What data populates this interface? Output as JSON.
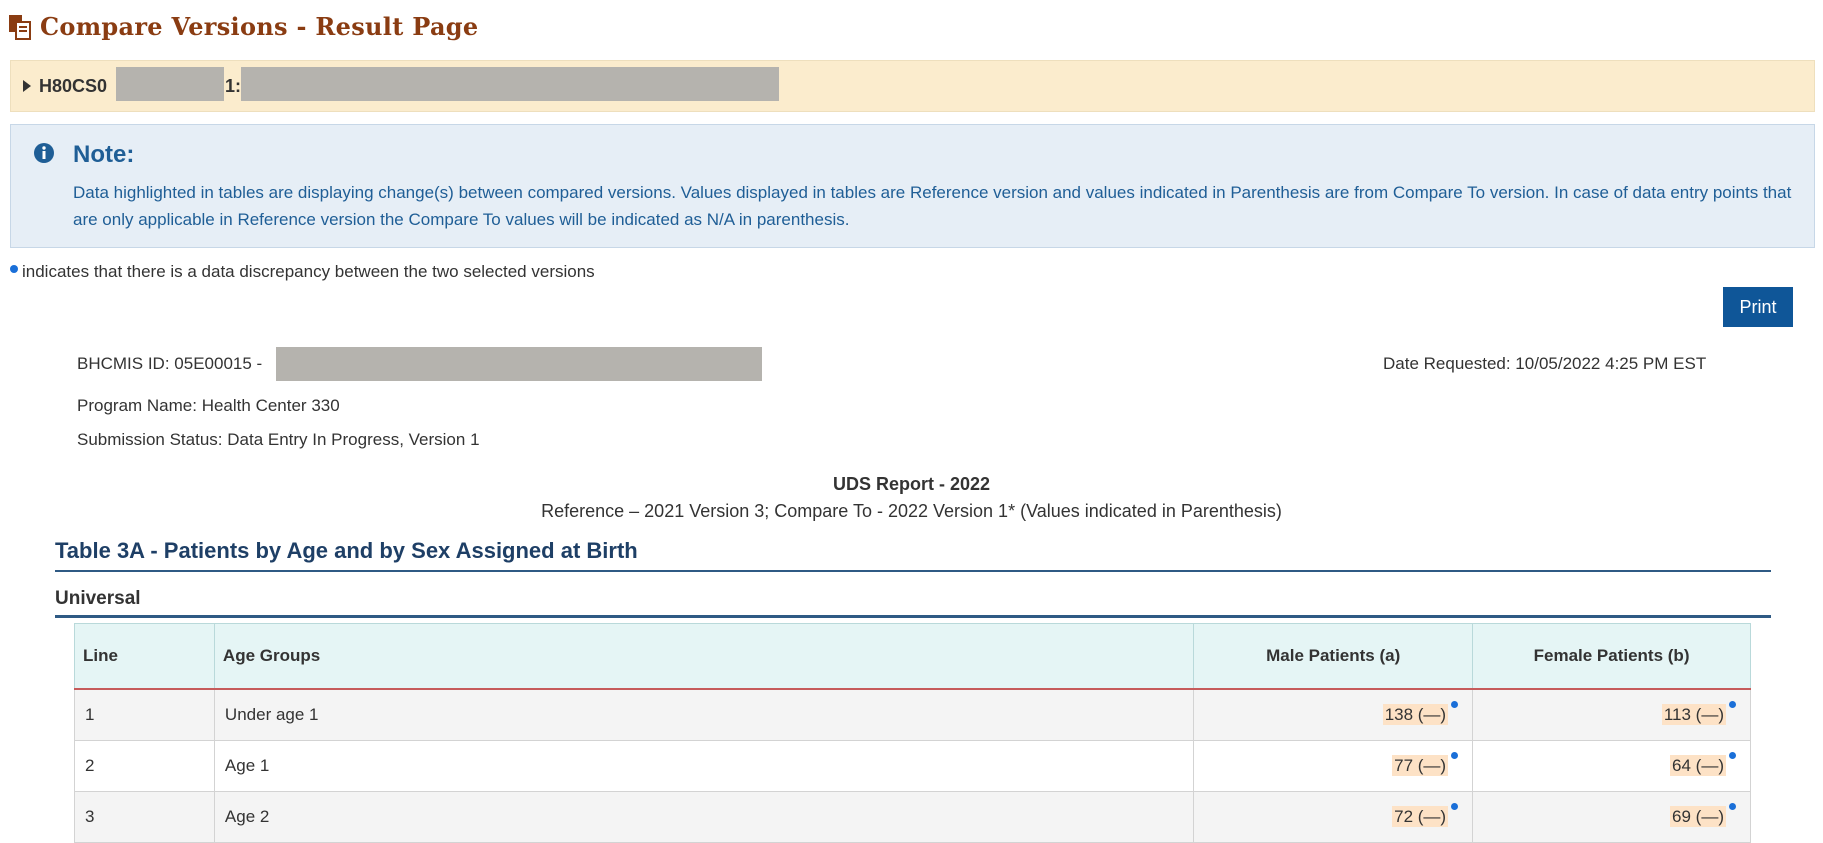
{
  "page": {
    "title": "Compare Versions - Result Page"
  },
  "grant_bar": {
    "id_prefix": "H80CS0",
    "id_suffix": "1:"
  },
  "note": {
    "title": "Note:",
    "text": "Data highlighted in tables are displaying change(s) between compared versions. Values displayed in tables are Reference version and values indicated in Parenthesis are from Compare To version. In case of data entry points that are only applicable in Reference version the Compare To values will be indicated as N/A in parenthesis."
  },
  "legend": {
    "text": "indicates that there is a data discrepancy between the two selected versions"
  },
  "toolbar": {
    "print_label": "Print"
  },
  "info": {
    "bhcmis": "BHCMIS ID: 05E00015 -",
    "date_requested": "Date Requested: 10/05/2022 4:25 PM EST",
    "program_name": "Program Name: Health Center 330",
    "submission_status": "Submission Status: Data Entry In Progress, Version 1"
  },
  "report": {
    "title": "UDS Report - 2022",
    "subtitle": "Reference –  2021 Version 3; Compare To - 2022 Version 1* (Values indicated in Parenthesis)"
  },
  "table_section": {
    "title": "Table 3A - Patients by Age and by Sex Assigned at Birth",
    "subsection": "Universal"
  },
  "table": {
    "headers": [
      "Line",
      "Age Groups",
      "Male Patients (a)",
      "Female Patients (b)"
    ],
    "rows": [
      {
        "line": "1",
        "age_group": "Under age 1",
        "male": "138 (—)",
        "female": "113 (—)"
      },
      {
        "line": "2",
        "age_group": "Age 1",
        "male": "77 (—)",
        "female": "64 (—)"
      },
      {
        "line": "3",
        "age_group": "Age 2",
        "male": "72 (—)",
        "female": "69 (—)"
      }
    ]
  },
  "colors": {
    "title": "#8a3c12",
    "accordion_bg": "#fbeccd",
    "note_bg": "#e6eef6",
    "note_text": "#1f5e96",
    "print_button": "#0f5698",
    "discrepancy_dot": "#1a6fd8",
    "highlight": "#fde2c6",
    "table_header_bg": "#e5f5f5"
  },
  "icons": {
    "title_icon": "copy-document-icon",
    "accordion_icon": "caret-right-icon",
    "note_icon": "info-circle-icon",
    "discrepancy_icon": "blue-dot-icon"
  }
}
